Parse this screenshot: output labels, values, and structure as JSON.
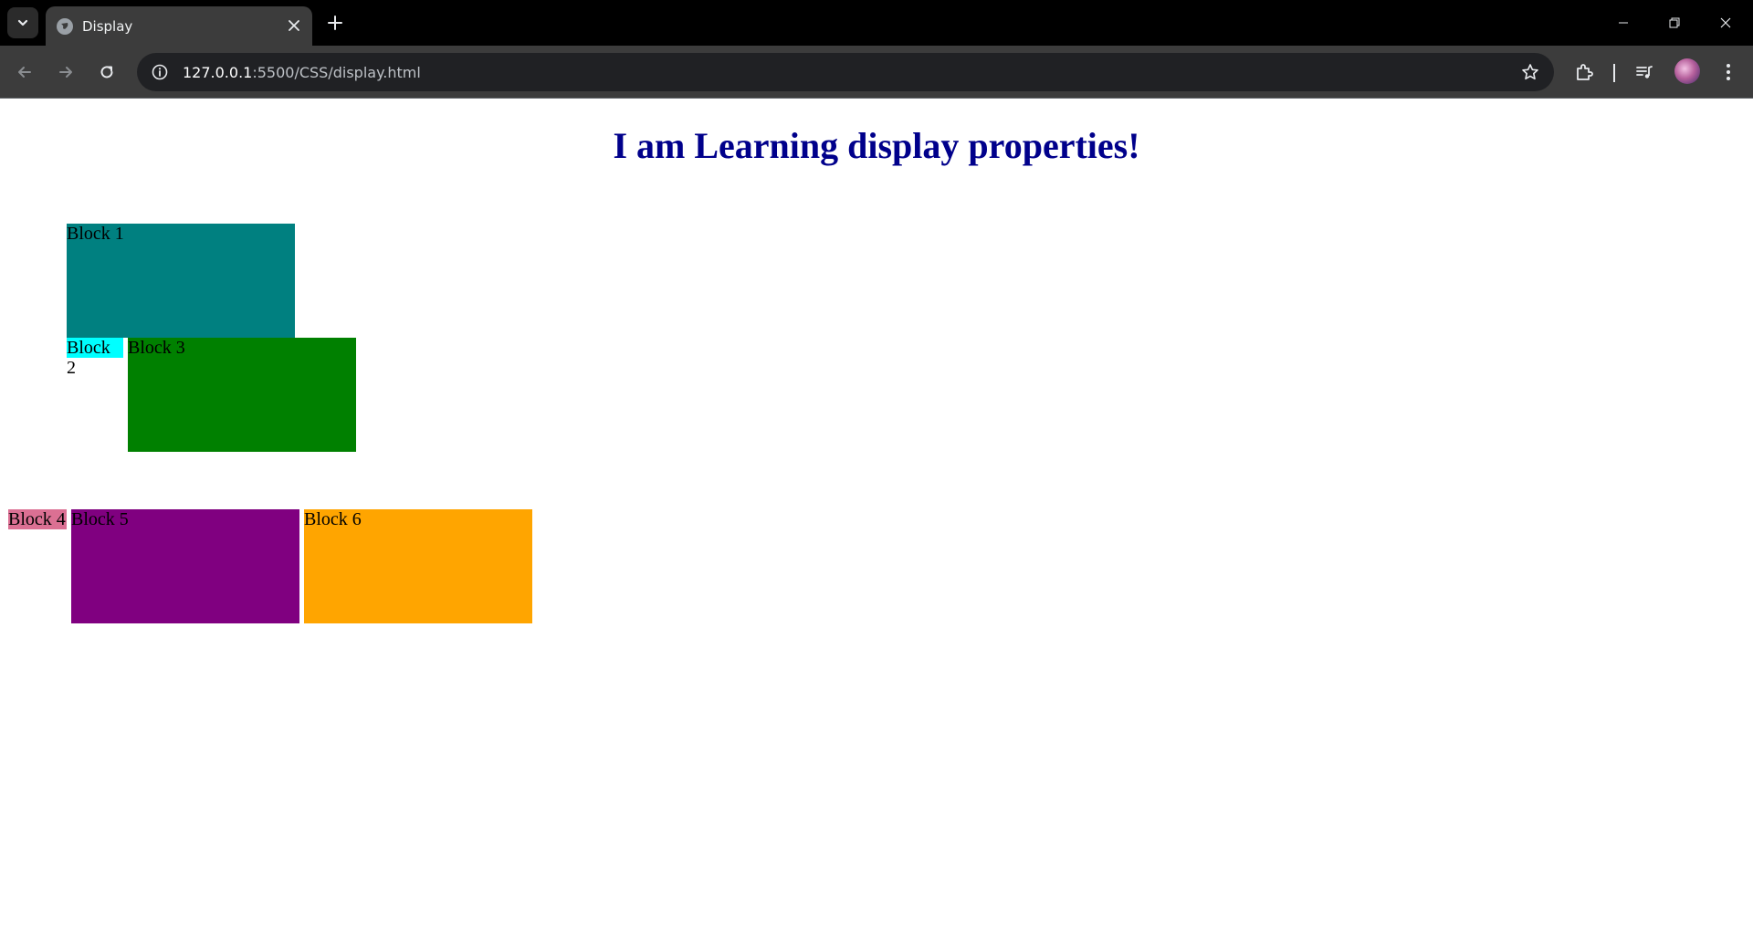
{
  "browser": {
    "tab": {
      "title": "Display",
      "close_label": "✕"
    },
    "new_tab_label": "+",
    "address_bar": {
      "host": "127.0.0.1",
      "path": ":5500/CSS/display.html"
    }
  },
  "page": {
    "heading": "I am Learning display properties!",
    "heading_color": "#00008b",
    "blocks": [
      {
        "label": "Block 1",
        "color": "#008080"
      },
      {
        "label": "Block 2",
        "color": "#00ffff"
      },
      {
        "label": "Block 3",
        "color": "#008000"
      },
      {
        "label": "Block 4",
        "color": "#db7093"
      },
      {
        "label": "Block 5",
        "color": "#800080"
      },
      {
        "label": "Block 6",
        "color": "#ffa500"
      }
    ]
  },
  "icons": {
    "tab_search": "chevron-down-icon",
    "favicon": "globe-icon",
    "back": "arrow-left-icon",
    "forward": "arrow-right-icon",
    "reload": "reload-icon",
    "site_info": "info-icon",
    "bookmark": "star-icon",
    "extensions": "puzzle-icon",
    "media": "playlist-icon",
    "menu": "kebab-menu-icon"
  }
}
